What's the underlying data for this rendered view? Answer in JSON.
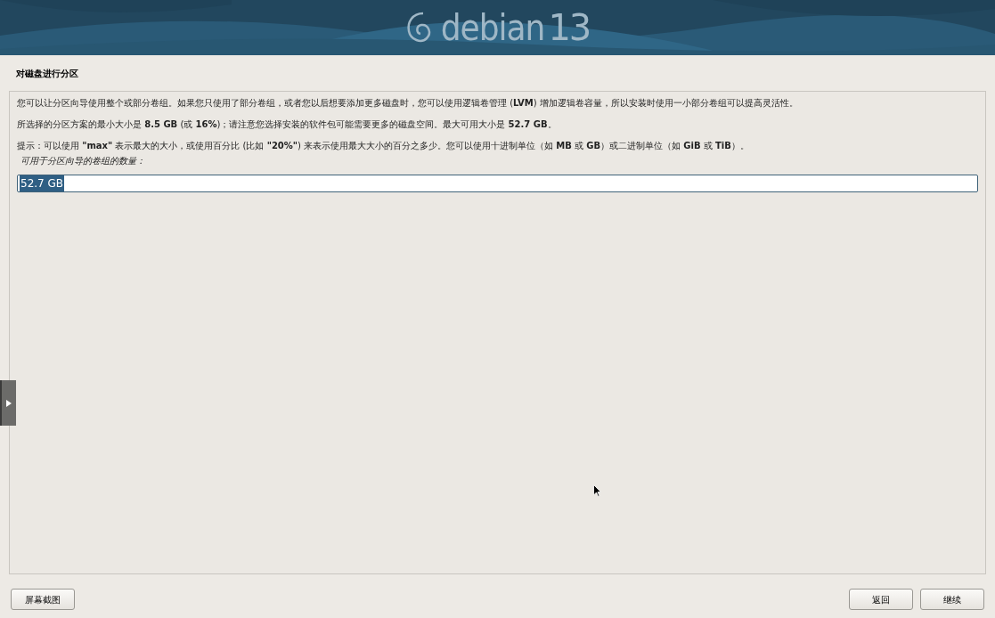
{
  "banner": {
    "logo_text": "debian",
    "version": "13"
  },
  "page_title": "对磁盘进行分区",
  "paragraphs": [
    "您可以让分区向导使用整个或部分卷组。如果您只使用了部分卷组，或者您以后想要添加更多磁盘时，您可以使用逻辑卷管理 (**LVM**) 增加逻辑卷容量，所以安装时使用一小部分卷组可以提高灵活性。",
    "所选择的分区方案的最小大小是 **8.5 GB** (或 **16%**)；请注意您选择安装的软件包可能需要更多的磁盘空间。最大可用大小是 **52.7 GB**。",
    "提示：可以使用 **\"max\"** 表示最大的大小，或使用百分比 (比如 **\"20%\"**) 来表示使用最大大小的百分之多少。您可以使用十进制单位（如 **MB** 或 **GB**）或二进制单位（如 **GiB** 或 **TiB**）。"
  ],
  "field": {
    "label": "可用于分区向导的卷组的数量：",
    "value": "52.7 GB",
    "value_selected": true
  },
  "buttons_left": [
    "屏幕截图"
  ],
  "buttons_right": [
    "返回",
    "继续"
  ]
}
